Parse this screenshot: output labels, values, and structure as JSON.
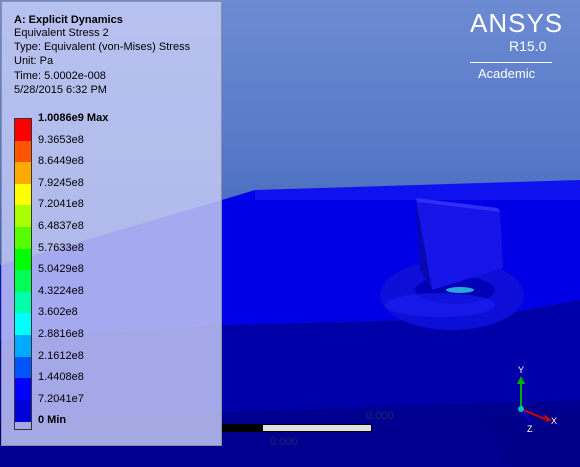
{
  "header": {
    "title": "A: Explicit Dynamics",
    "result_name": "Equivalent Stress 2",
    "type": "Type: Equivalent (von-Mises) Stress",
    "unit": "Unit: Pa",
    "time": "Time: 5.0002e-008",
    "date": "5/28/2015 6:32 PM"
  },
  "legend": {
    "entries": [
      {
        "label": "1.0086e9 Max",
        "color": "#ff0000"
      },
      {
        "label": "9.3653e8",
        "color": "#ff5500"
      },
      {
        "label": "8.6449e8",
        "color": "#ffaa00"
      },
      {
        "label": "7.9245e8",
        "color": "#ffff00"
      },
      {
        "label": "7.2041e8",
        "color": "#aaff00"
      },
      {
        "label": "6.4837e8",
        "color": "#55ff00"
      },
      {
        "label": "5.7633e8",
        "color": "#00ff00"
      },
      {
        "label": "5.0429e8",
        "color": "#00ff55"
      },
      {
        "label": "4.3224e8",
        "color": "#00ffaa"
      },
      {
        "label": "3.602e8",
        "color": "#00ffff"
      },
      {
        "label": "2.8816e8",
        "color": "#00aaff"
      },
      {
        "label": "2.1612e8",
        "color": "#0055ff"
      },
      {
        "label": "1.4408e8",
        "color": "#0000ff"
      },
      {
        "label": "7.2041e7",
        "color": "#0000d8"
      },
      {
        "label": "0 Min",
        "color": "#0000b0"
      }
    ]
  },
  "logo": {
    "brand": "ANSYS",
    "version": "R15.0",
    "edition": "Academic"
  },
  "scale": {
    "top_label": "0.000",
    "mid_label": "0.000"
  },
  "triad": {
    "y_label": "Y",
    "x_label": "X",
    "z_label": "Z"
  }
}
